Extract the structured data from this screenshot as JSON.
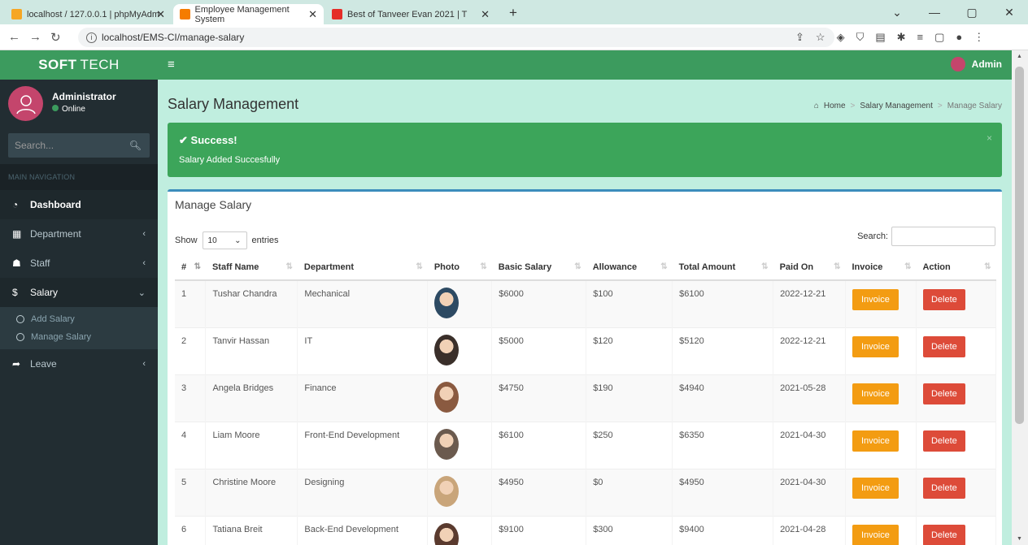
{
  "browser": {
    "tabs": [
      {
        "title": "localhost / 127.0.0.1 | phpMyAdm",
        "color": "#f6a623"
      },
      {
        "title": "Employee Management System",
        "color": "#f57c00"
      },
      {
        "title": "Best of Tanveer Evan 2021 | T",
        "color": "#e52d27"
      }
    ],
    "url": "localhost/EMS-CI/manage-salary"
  },
  "brand": {
    "bold": "SOFT",
    "rest": "TECH"
  },
  "user": {
    "name": "Administrator",
    "status": "Online"
  },
  "sidebar": {
    "search_placeholder": "Search...",
    "header": "MAIN NAVIGATION",
    "items": [
      {
        "label": "Dashboard",
        "icon": "dashboard-icon"
      },
      {
        "label": "Department",
        "icon": "department-icon"
      },
      {
        "label": "Staff",
        "icon": "staff-icon"
      },
      {
        "label": "Salary",
        "icon": "dollar-icon"
      },
      {
        "label": "Leave",
        "icon": "arrow-icon"
      }
    ],
    "salary_sub": [
      "Add Salary",
      "Manage Salary"
    ]
  },
  "topnav": {
    "user": "Admin"
  },
  "page": {
    "title": "Salary Management",
    "breadcrumb": [
      "Home",
      "Salary Management",
      "Manage Salary"
    ]
  },
  "alert": {
    "title": "Success!",
    "message": "Salary Added Succesfully"
  },
  "box": {
    "title": "Manage Salary",
    "show_label": "Show",
    "entries_value": "10",
    "entries_label": "entries",
    "search_label": "Search:"
  },
  "table": {
    "columns": [
      "#",
      "Staff Name",
      "Department",
      "Photo",
      "Basic Salary",
      "Allowance",
      "Total Amount",
      "Paid On",
      "Invoice",
      "Action"
    ],
    "invoice_label": "Invoice",
    "delete_label": "Delete",
    "rows": [
      {
        "n": "1",
        "name": "Tushar Chandra",
        "dept": "Mechanical",
        "basic": "$6000",
        "allow": "$100",
        "total": "$6100",
        "paid": "2022-12-21",
        "photo": "#2d4a63"
      },
      {
        "n": "2",
        "name": "Tanvir Hassan",
        "dept": "IT",
        "basic": "$5000",
        "allow": "$120",
        "total": "$5120",
        "paid": "2022-12-21",
        "photo": "#3a2f2a"
      },
      {
        "n": "3",
        "name": "Angela Bridges",
        "dept": "Finance",
        "basic": "$4750",
        "allow": "$190",
        "total": "$4940",
        "paid": "2021-05-28",
        "photo": "#8a5a40"
      },
      {
        "n": "4",
        "name": "Liam Moore",
        "dept": "Front-End Development",
        "basic": "$6100",
        "allow": "$250",
        "total": "$6350",
        "paid": "2021-04-30",
        "photo": "#6b5a4e"
      },
      {
        "n": "5",
        "name": "Christine Moore",
        "dept": "Designing",
        "basic": "$4950",
        "allow": "$0",
        "total": "$4950",
        "paid": "2021-04-30",
        "photo": "#c9a57a"
      },
      {
        "n": "6",
        "name": "Tatiana Breit",
        "dept": "Back-End Development",
        "basic": "$9100",
        "allow": "$300",
        "total": "$9400",
        "paid": "2021-04-28",
        "photo": "#5a3a2e"
      }
    ]
  },
  "colors": {
    "brand": "#3c9b5e",
    "sidebar": "#222d32",
    "content": "#c0eedf",
    "invoice": "#f39c12",
    "delete": "#dd4b39"
  }
}
